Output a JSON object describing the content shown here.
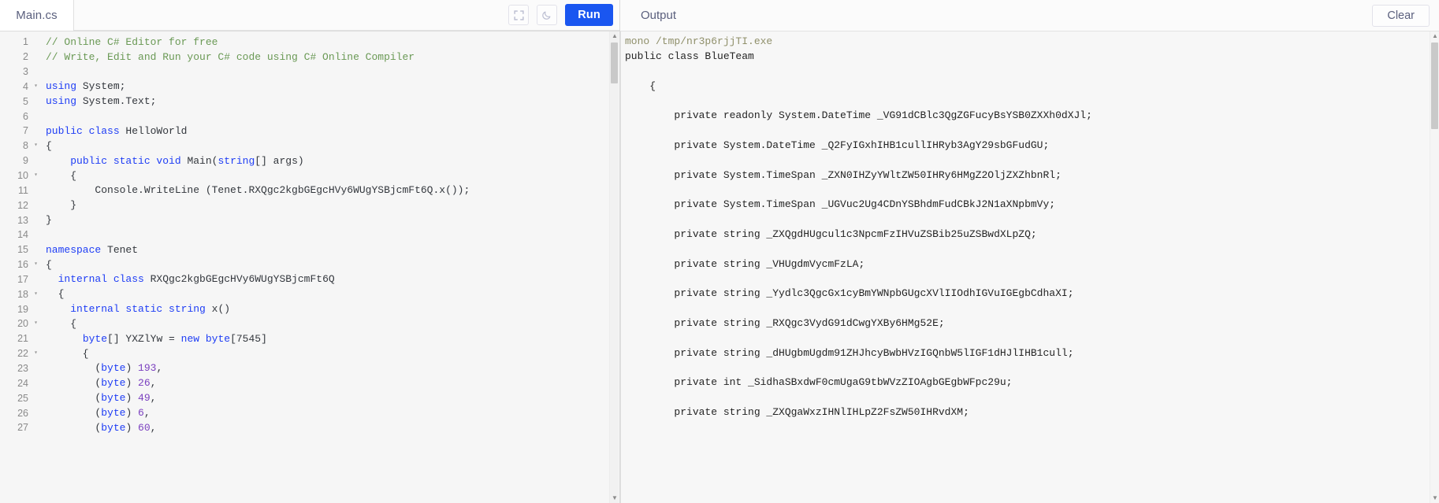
{
  "editor": {
    "tab_label": "Main.cs",
    "fullscreen_icon": "fullscreen-icon",
    "theme_icon": "moon-icon",
    "run_label": "Run",
    "lines": [
      {
        "n": "1",
        "fold": false,
        "tokens": [
          {
            "t": "// Online C# Editor for free",
            "c": "c-com"
          }
        ]
      },
      {
        "n": "2",
        "fold": false,
        "tokens": [
          {
            "t": "// Write, Edit and Run your C# code using C# Online Compiler",
            "c": "c-com"
          }
        ]
      },
      {
        "n": "3",
        "fold": false,
        "tokens": []
      },
      {
        "n": "4",
        "fold": true,
        "tokens": [
          {
            "t": "using",
            "c": "c-kw"
          },
          {
            "t": " System;",
            "c": "c-pln"
          }
        ]
      },
      {
        "n": "5",
        "fold": false,
        "tokens": [
          {
            "t": "using",
            "c": "c-kw"
          },
          {
            "t": " System.Text;",
            "c": "c-pln"
          }
        ]
      },
      {
        "n": "6",
        "fold": false,
        "tokens": []
      },
      {
        "n": "7",
        "fold": false,
        "tokens": [
          {
            "t": "public class",
            "c": "c-kw"
          },
          {
            "t": " HelloWorld",
            "c": "c-pln"
          }
        ]
      },
      {
        "n": "8",
        "fold": true,
        "tokens": [
          {
            "t": "{",
            "c": "c-pln"
          }
        ]
      },
      {
        "n": "9",
        "fold": false,
        "tokens": [
          {
            "t": "    ",
            "c": "c-pln"
          },
          {
            "t": "public static void",
            "c": "c-kw"
          },
          {
            "t": " Main(",
            "c": "c-pln"
          },
          {
            "t": "string",
            "c": "c-kw"
          },
          {
            "t": "[] args)",
            "c": "c-pln"
          }
        ]
      },
      {
        "n": "10",
        "fold": true,
        "tokens": [
          {
            "t": "    {",
            "c": "c-pln"
          }
        ]
      },
      {
        "n": "11",
        "fold": false,
        "tokens": [
          {
            "t": "        Console.WriteLine (Tenet.RXQgc2kgbGEgcHVy6WUgYSBjcmFt6Q.x());",
            "c": "c-pln"
          }
        ]
      },
      {
        "n": "12",
        "fold": false,
        "tokens": [
          {
            "t": "    }",
            "c": "c-pln"
          }
        ]
      },
      {
        "n": "13",
        "fold": false,
        "tokens": [
          {
            "t": "}",
            "c": "c-pln"
          }
        ]
      },
      {
        "n": "14",
        "fold": false,
        "tokens": []
      },
      {
        "n": "15",
        "fold": false,
        "tokens": [
          {
            "t": "namespace",
            "c": "c-kw"
          },
          {
            "t": " Tenet",
            "c": "c-pln"
          }
        ]
      },
      {
        "n": "16",
        "fold": true,
        "tokens": [
          {
            "t": "{",
            "c": "c-pln"
          }
        ]
      },
      {
        "n": "17",
        "fold": false,
        "tokens": [
          {
            "t": "  ",
            "c": "c-pln"
          },
          {
            "t": "internal class",
            "c": "c-kw"
          },
          {
            "t": " RXQgc2kgbGEgcHVy6WUgYSBjcmFt6Q",
            "c": "c-pln"
          }
        ]
      },
      {
        "n": "18",
        "fold": true,
        "tokens": [
          {
            "t": "  {",
            "c": "c-pln"
          }
        ]
      },
      {
        "n": "19",
        "fold": false,
        "tokens": [
          {
            "t": "    ",
            "c": "c-pln"
          },
          {
            "t": "internal static string",
            "c": "c-kw"
          },
          {
            "t": " x()",
            "c": "c-pln"
          }
        ]
      },
      {
        "n": "20",
        "fold": true,
        "tokens": [
          {
            "t": "    {",
            "c": "c-pln"
          }
        ]
      },
      {
        "n": "21",
        "fold": false,
        "tokens": [
          {
            "t": "      ",
            "c": "c-pln"
          },
          {
            "t": "byte",
            "c": "c-kw"
          },
          {
            "t": "[] YXZlYw = ",
            "c": "c-pln"
          },
          {
            "t": "new byte",
            "c": "c-kw"
          },
          {
            "t": "[7545]",
            "c": "c-pln"
          }
        ]
      },
      {
        "n": "22",
        "fold": true,
        "tokens": [
          {
            "t": "      {",
            "c": "c-pln"
          }
        ]
      },
      {
        "n": "23",
        "fold": false,
        "tokens": [
          {
            "t": "        (",
            "c": "c-pln"
          },
          {
            "t": "byte",
            "c": "c-kw"
          },
          {
            "t": ") ",
            "c": "c-pln"
          },
          {
            "t": "193",
            "c": "c-num"
          },
          {
            "t": ",",
            "c": "c-pln"
          }
        ]
      },
      {
        "n": "24",
        "fold": false,
        "tokens": [
          {
            "t": "        (",
            "c": "c-pln"
          },
          {
            "t": "byte",
            "c": "c-kw"
          },
          {
            "t": ") ",
            "c": "c-pln"
          },
          {
            "t": "26",
            "c": "c-num"
          },
          {
            "t": ",",
            "c": "c-pln"
          }
        ]
      },
      {
        "n": "25",
        "fold": false,
        "tokens": [
          {
            "t": "        (",
            "c": "c-pln"
          },
          {
            "t": "byte",
            "c": "c-kw"
          },
          {
            "t": ") ",
            "c": "c-pln"
          },
          {
            "t": "49",
            "c": "c-num"
          },
          {
            "t": ",",
            "c": "c-pln"
          }
        ]
      },
      {
        "n": "26",
        "fold": false,
        "tokens": [
          {
            "t": "        (",
            "c": "c-pln"
          },
          {
            "t": "byte",
            "c": "c-kw"
          },
          {
            "t": ") ",
            "c": "c-pln"
          },
          {
            "t": "6",
            "c": "c-num"
          },
          {
            "t": ",",
            "c": "c-pln"
          }
        ]
      },
      {
        "n": "27",
        "fold": false,
        "tokens": [
          {
            "t": "        (",
            "c": "c-pln"
          },
          {
            "t": "byte",
            "c": "c-kw"
          },
          {
            "t": ") ",
            "c": "c-pln"
          },
          {
            "t": "60",
            "c": "c-num"
          },
          {
            "t": ",",
            "c": "c-pln"
          }
        ]
      }
    ]
  },
  "output": {
    "title": "Output",
    "clear_label": "Clear",
    "lines": [
      {
        "t": "mono /tmp/nr3p6rjjTI.exe",
        "c": "cmd"
      },
      {
        "t": "public class BlueTeam",
        "c": ""
      },
      {
        "t": "",
        "c": ""
      },
      {
        "t": "    {",
        "c": ""
      },
      {
        "t": "",
        "c": ""
      },
      {
        "t": "        private readonly System.DateTime _VG91dCBlc3QgZGFucyBsYSB0ZXXh0dXJl;",
        "c": ""
      },
      {
        "t": "",
        "c": ""
      },
      {
        "t": "        private System.DateTime _Q2FyIGxhIHB1cullIHRyb3AgY29sbGFudGU;",
        "c": ""
      },
      {
        "t": "",
        "c": ""
      },
      {
        "t": "        private System.TimeSpan _ZXN0IHZyYWltZW50IHRy6HMgZ2OljZXZhbnRl;",
        "c": ""
      },
      {
        "t": "",
        "c": ""
      },
      {
        "t": "        private System.TimeSpan _UGVuc2Ug4CDnYSBhdmFudCBkJ2N1aXNpbmVy;",
        "c": ""
      },
      {
        "t": "",
        "c": ""
      },
      {
        "t": "        private string _ZXQgdHUgcul1c3NpcmFzIHVuZSBib25uZSBwdXLpZQ;",
        "c": ""
      },
      {
        "t": "",
        "c": ""
      },
      {
        "t": "        private string _VHUgdmVycmFzLA;",
        "c": ""
      },
      {
        "t": "",
        "c": ""
      },
      {
        "t": "        private string _Yydlc3QgcGx1cyBmYWNpbGUgcXVlIIOdhIGVuIGEgbCdhaXI;",
        "c": ""
      },
      {
        "t": "",
        "c": ""
      },
      {
        "t": "        private string _RXQgc3VydG91dCwgYXBy6HMg52E;",
        "c": ""
      },
      {
        "t": "",
        "c": ""
      },
      {
        "t": "        private string _dHUgbmUgdm91ZHJhcyBwbHVzIGQnbW5lIGF1dHJlIHB1cull;",
        "c": ""
      },
      {
        "t": "",
        "c": ""
      },
      {
        "t": "        private int _SidhaSBxdwF0cmUgaG9tbWVzZIOAgbGEgbWFpc29u;",
        "c": ""
      },
      {
        "t": "",
        "c": ""
      },
      {
        "t": "        private string _ZXQgaWxzIHNlIHLpZ2FsZW50IHRvdXM;",
        "c": ""
      }
    ]
  }
}
